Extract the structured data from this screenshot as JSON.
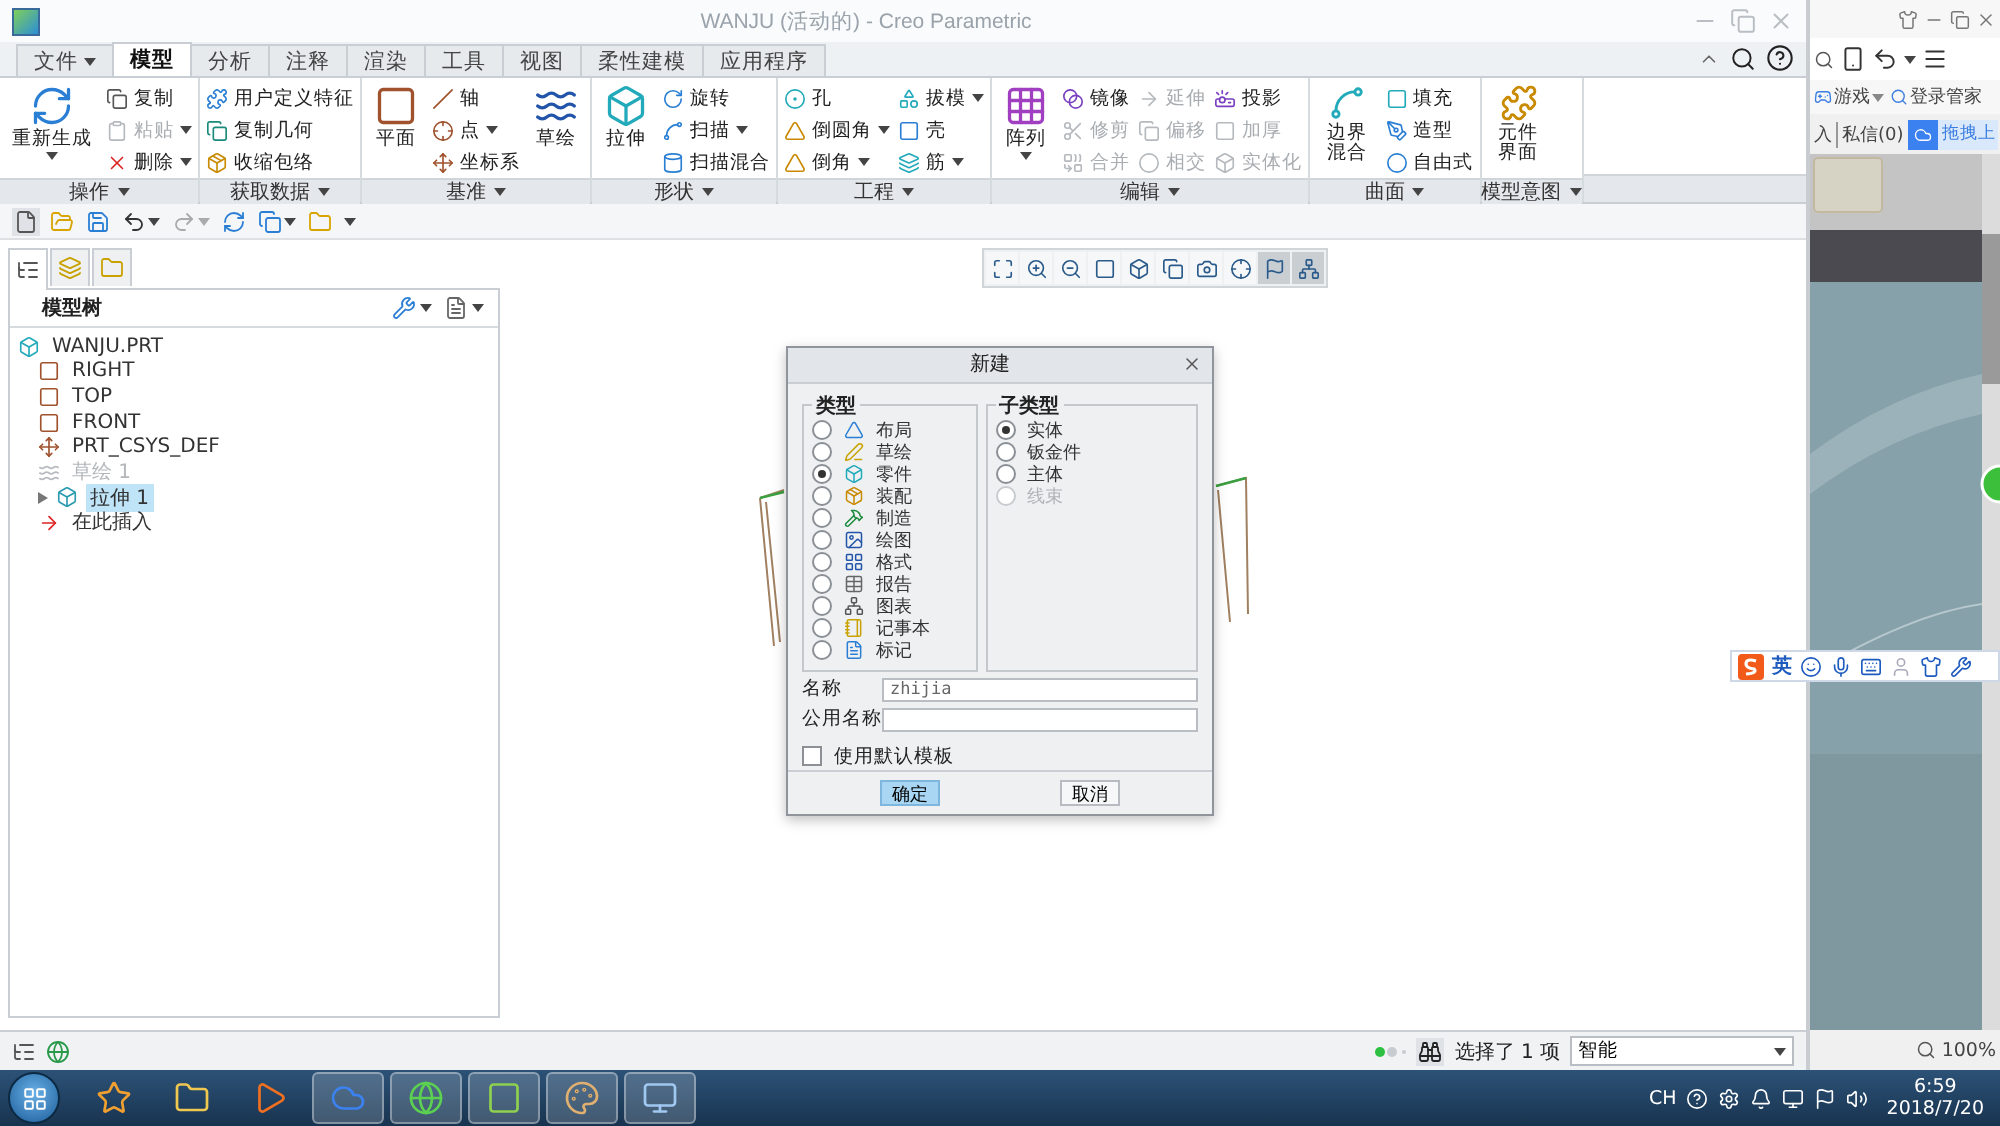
{
  "window": {
    "title": "WANJU (活动的) - Creo Parametric"
  },
  "menu_tabs": [
    {
      "label": "文件",
      "kind": "menu",
      "selected": false
    },
    {
      "label": "模型",
      "kind": "tab",
      "selected": true
    },
    {
      "label": "分析",
      "kind": "tab",
      "selected": false
    },
    {
      "label": "注释",
      "kind": "tab",
      "selected": false
    },
    {
      "label": "渲染",
      "kind": "tab",
      "selected": false
    },
    {
      "label": "工具",
      "kind": "tab",
      "selected": false
    },
    {
      "label": "视图",
      "kind": "tab",
      "selected": false
    },
    {
      "label": "柔性建模",
      "kind": "tab",
      "selected": false
    },
    {
      "label": "应用程序",
      "kind": "tab",
      "selected": false
    }
  ],
  "ribbon": {
    "groups": [
      {
        "label": "操作",
        "items": [
          {
            "label": "重新生成",
            "kind": "large",
            "dropdown": true,
            "disabled": false
          },
          {
            "label": "复制",
            "kind": "small",
            "dropdown": false,
            "disabled": false
          },
          {
            "label": "粘贴",
            "kind": "small",
            "dropdown": true,
            "disabled": true
          },
          {
            "label": "删除",
            "kind": "small",
            "dropdown": true,
            "disabled": false
          }
        ]
      },
      {
        "label": "获取数据",
        "items": [
          {
            "label": "用户定义特征",
            "kind": "small",
            "dropdown": false,
            "disabled": false
          },
          {
            "label": "复制几何",
            "kind": "small",
            "dropdown": false,
            "disabled": false
          },
          {
            "label": "收缩包络",
            "kind": "small",
            "dropdown": false,
            "disabled": false
          }
        ]
      },
      {
        "label": "基准",
        "items": [
          {
            "label": "平面",
            "kind": "large",
            "dropdown": false,
            "disabled": false
          },
          {
            "label": "轴",
            "kind": "small",
            "dropdown": false,
            "disabled": false
          },
          {
            "label": "点",
            "kind": "small",
            "dropdown": true,
            "disabled": false
          },
          {
            "label": "坐标系",
            "kind": "small",
            "dropdown": false,
            "disabled": false
          },
          {
            "label": "草绘",
            "kind": "large",
            "dropdown": false,
            "disabled": false
          }
        ]
      },
      {
        "label": "形状",
        "items": [
          {
            "label": "拉伸",
            "kind": "large",
            "dropdown": false,
            "disabled": false
          },
          {
            "label": "旋转",
            "kind": "small",
            "dropdown": false,
            "disabled": false
          },
          {
            "label": "扫描",
            "kind": "small",
            "dropdown": true,
            "disabled": false
          },
          {
            "label": "扫描混合",
            "kind": "small",
            "dropdown": false,
            "disabled": false
          }
        ]
      },
      {
        "label": "工程",
        "items": [
          {
            "label": "孔",
            "kind": "small",
            "dropdown": false,
            "disabled": false
          },
          {
            "label": "倒圆角",
            "kind": "small",
            "dropdown": true,
            "disabled": false
          },
          {
            "label": "倒角",
            "kind": "small",
            "dropdown": true,
            "disabled": false
          },
          {
            "label": "拔模",
            "kind": "small",
            "dropdown": true,
            "disabled": false
          },
          {
            "label": "壳",
            "kind": "small",
            "dropdown": false,
            "disabled": false
          },
          {
            "label": "筋",
            "kind": "small",
            "dropdown": true,
            "disabled": false
          }
        ]
      },
      {
        "label": "编辑",
        "items": [
          {
            "label": "阵列",
            "kind": "large",
            "dropdown": true,
            "disabled": false
          },
          {
            "label": "镜像",
            "kind": "small",
            "dropdown": false,
            "disabled": false
          },
          {
            "label": "修剪",
            "kind": "small",
            "dropdown": false,
            "disabled": true
          },
          {
            "label": "合并",
            "kind": "small",
            "dropdown": false,
            "disabled": true
          },
          {
            "label": "延伸",
            "kind": "small",
            "dropdown": false,
            "disabled": true
          },
          {
            "label": "偏移",
            "kind": "small",
            "dropdown": false,
            "disabled": true
          },
          {
            "label": "相交",
            "kind": "small",
            "dropdown": false,
            "disabled": true
          },
          {
            "label": "投影",
            "kind": "small",
            "dropdown": false,
            "disabled": false
          },
          {
            "label": "加厚",
            "kind": "small",
            "dropdown": false,
            "disabled": true
          },
          {
            "label": "实体化",
            "kind": "small",
            "dropdown": false,
            "disabled": true
          }
        ]
      },
      {
        "label": "曲面",
        "items": [
          {
            "label": "边界混合",
            "kind": "stacked",
            "dropdown": false,
            "disabled": false
          },
          {
            "label": "填充",
            "kind": "small",
            "dropdown": false,
            "disabled": false
          },
          {
            "label": "造型",
            "kind": "small",
            "dropdown": false,
            "disabled": false
          },
          {
            "label": "自由式",
            "kind": "small",
            "dropdown": false,
            "disabled": false
          }
        ]
      },
      {
        "label": "模型意图",
        "items": [
          {
            "label": "元件界面",
            "kind": "stacked",
            "dropdown": false,
            "disabled": false
          }
        ]
      }
    ]
  },
  "view_toolbar": {
    "buttons": [
      {
        "pressed": false
      },
      {
        "pressed": false
      },
      {
        "pressed": false
      },
      {
        "pressed": false
      },
      {
        "pressed": false
      },
      {
        "pressed": false
      },
      {
        "pressed": false
      },
      {
        "pressed": false
      },
      {
        "pressed": true
      },
      {
        "pressed": true
      }
    ]
  },
  "panel_tabs": [
    {
      "selected": true
    },
    {
      "selected": false
    },
    {
      "selected": false
    }
  ],
  "model_tree": {
    "title": "模型树",
    "items": [
      {
        "label": "WANJU.PRT",
        "kind": "part",
        "selected": false,
        "disabled": false,
        "children": [
          {
            "label": "RIGHT",
            "kind": "plane",
            "selected": false,
            "disabled": false
          },
          {
            "label": "TOP",
            "kind": "plane",
            "selected": false,
            "disabled": false
          },
          {
            "label": "FRONT",
            "kind": "plane",
            "selected": false,
            "disabled": false
          },
          {
            "label": "PRT_CSYS_DEF",
            "kind": "csys",
            "selected": false,
            "disabled": false
          },
          {
            "label": "草绘 1",
            "kind": "sketch",
            "selected": false,
            "disabled": true
          },
          {
            "label": "拉伸 1",
            "kind": "extrude",
            "selected": true,
            "disabled": false,
            "expanded": false
          },
          {
            "label": "在此插入",
            "kind": "insert",
            "selected": false,
            "disabled": false
          }
        ]
      }
    ]
  },
  "dialog": {
    "title": "新建",
    "type_group": {
      "title": "类型",
      "options": [
        {
          "label": "布局",
          "selected": false
        },
        {
          "label": "草绘",
          "selected": false
        },
        {
          "label": "零件",
          "selected": true
        },
        {
          "label": "装配",
          "selected": false
        },
        {
          "label": "制造",
          "selected": false
        },
        {
          "label": "绘图",
          "selected": false
        },
        {
          "label": "格式",
          "selected": false
        },
        {
          "label": "报告",
          "selected": false
        },
        {
          "label": "图表",
          "selected": false
        },
        {
          "label": "记事本",
          "selected": false
        },
        {
          "label": "标记",
          "selected": false
        }
      ]
    },
    "subtype_group": {
      "title": "子类型",
      "options": [
        {
          "label": "实体",
          "selected": true,
          "disabled": false
        },
        {
          "label": "钣金件",
          "selected": false,
          "disabled": false
        },
        {
          "label": "主体",
          "selected": false,
          "disabled": false
        },
        {
          "label": "线束",
          "selected": false,
          "disabled": true
        }
      ]
    },
    "fields": [
      {
        "label": "名称",
        "value": "zhijia"
      },
      {
        "label": "公用名称"
      }
    ],
    "checkbox": {
      "label": "使用默认模板",
      "checked": false
    },
    "buttons": [
      {
        "label": "确定",
        "primary": true
      },
      {
        "label": "取消",
        "primary": false
      }
    ]
  },
  "status_bar": {
    "selection": "选择了 1 项",
    "filter": "智能"
  },
  "side_browser": {
    "nav": [
      {
        "label": "游戏",
        "dropdown": true
      },
      {
        "label": "登录管家",
        "dropdown": false
      }
    ],
    "links": [
      "入",
      "私信(0)"
    ],
    "upload_button": "拖拽上",
    "zoom": "100%"
  },
  "ime_bar": {
    "mode": "英"
  },
  "taskbar": {
    "apps": [
      {
        "active": false
      },
      {
        "active": false
      },
      {
        "active": false
      },
      {
        "active": true
      },
      {
        "active": true
      },
      {
        "active": true
      },
      {
        "active": true
      },
      {
        "active": true
      }
    ],
    "tray": {
      "language": "CH",
      "time": "6:59",
      "date": "2018/7/20"
    }
  }
}
